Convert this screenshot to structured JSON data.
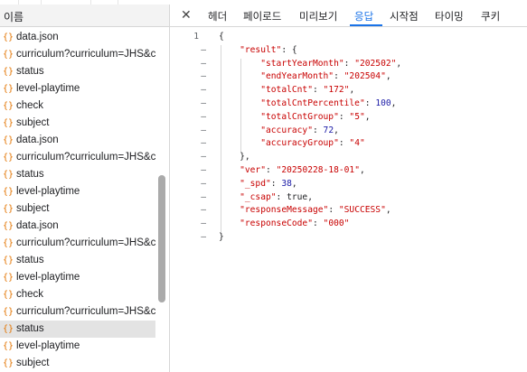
{
  "left_pane": {
    "header": "이름",
    "requests": [
      {
        "name": "data.json",
        "selected": false
      },
      {
        "name": "curriculum?curriculum=JHS&c...",
        "selected": false
      },
      {
        "name": "status",
        "selected": false
      },
      {
        "name": "level-playtime",
        "selected": false
      },
      {
        "name": "check",
        "selected": false
      },
      {
        "name": "subject",
        "selected": false
      },
      {
        "name": "data.json",
        "selected": false
      },
      {
        "name": "curriculum?curriculum=JHS&c...",
        "selected": false
      },
      {
        "name": "status",
        "selected": false
      },
      {
        "name": "level-playtime",
        "selected": false
      },
      {
        "name": "subject",
        "selected": false
      },
      {
        "name": "data.json",
        "selected": false
      },
      {
        "name": "curriculum?curriculum=JHS&c...",
        "selected": false
      },
      {
        "name": "status",
        "selected": false
      },
      {
        "name": "level-playtime",
        "selected": false
      },
      {
        "name": "check",
        "selected": false
      },
      {
        "name": "curriculum?curriculum=JHS&c...",
        "selected": false
      },
      {
        "name": "status",
        "selected": true
      },
      {
        "name": "level-playtime",
        "selected": false
      },
      {
        "name": "subject",
        "selected": false
      }
    ],
    "row_icon": "{}"
  },
  "tabs": {
    "close_symbol": "✕",
    "items": [
      "헤더",
      "페이로드",
      "미리보기",
      "응답",
      "시작점",
      "타이밍",
      "쿠키"
    ],
    "active": "응답"
  },
  "response": {
    "gutter_first_line": "1",
    "gutter_marker": "–",
    "lines": [
      [
        [
          "p",
          "{"
        ]
      ],
      [
        [
          "p",
          "    "
        ],
        [
          "k",
          "\"result\""
        ],
        [
          "p",
          ": {"
        ]
      ],
      [
        [
          "p",
          "        "
        ],
        [
          "k",
          "\"startYearMonth\""
        ],
        [
          "p",
          ": "
        ],
        [
          "s",
          "\"202502\""
        ],
        [
          "p",
          ","
        ]
      ],
      [
        [
          "p",
          "        "
        ],
        [
          "k",
          "\"endYearMonth\""
        ],
        [
          "p",
          ": "
        ],
        [
          "s",
          "\"202504\""
        ],
        [
          "p",
          ","
        ]
      ],
      [
        [
          "p",
          "        "
        ],
        [
          "k",
          "\"totalCnt\""
        ],
        [
          "p",
          ": "
        ],
        [
          "s",
          "\"172\""
        ],
        [
          "p",
          ","
        ]
      ],
      [
        [
          "p",
          "        "
        ],
        [
          "k",
          "\"totalCntPercentile\""
        ],
        [
          "p",
          ": "
        ],
        [
          "n",
          "100"
        ],
        [
          "p",
          ","
        ]
      ],
      [
        [
          "p",
          "        "
        ],
        [
          "k",
          "\"totalCntGroup\""
        ],
        [
          "p",
          ": "
        ],
        [
          "s",
          "\"5\""
        ],
        [
          "p",
          ","
        ]
      ],
      [
        [
          "p",
          "        "
        ],
        [
          "k",
          "\"accuracy\""
        ],
        [
          "p",
          ": "
        ],
        [
          "n",
          "72"
        ],
        [
          "p",
          ","
        ]
      ],
      [
        [
          "p",
          "        "
        ],
        [
          "k",
          "\"accuracyGroup\""
        ],
        [
          "p",
          ": "
        ],
        [
          "s",
          "\"4\""
        ]
      ],
      [
        [
          "p",
          "    },"
        ]
      ],
      [
        [
          "p",
          "    "
        ],
        [
          "k",
          "\"ver\""
        ],
        [
          "p",
          ": "
        ],
        [
          "s",
          "\"20250228-18-01\""
        ],
        [
          "p",
          ","
        ]
      ],
      [
        [
          "p",
          "    "
        ],
        [
          "k",
          "\"_spd\""
        ],
        [
          "p",
          ": "
        ],
        [
          "n",
          "38"
        ],
        [
          "p",
          ","
        ]
      ],
      [
        [
          "p",
          "    "
        ],
        [
          "k",
          "\"_csap\""
        ],
        [
          "p",
          ": true,"
        ]
      ],
      [
        [
          "p",
          "    "
        ],
        [
          "k",
          "\"responseMessage\""
        ],
        [
          "p",
          ": "
        ],
        [
          "s",
          "\"SUCCESS\""
        ],
        [
          "p",
          ","
        ]
      ],
      [
        [
          "p",
          "    "
        ],
        [
          "k",
          "\"responseCode\""
        ],
        [
          "p",
          ": "
        ],
        [
          "s",
          "\"000\""
        ]
      ],
      [
        [
          "p",
          "}"
        ]
      ]
    ]
  }
}
